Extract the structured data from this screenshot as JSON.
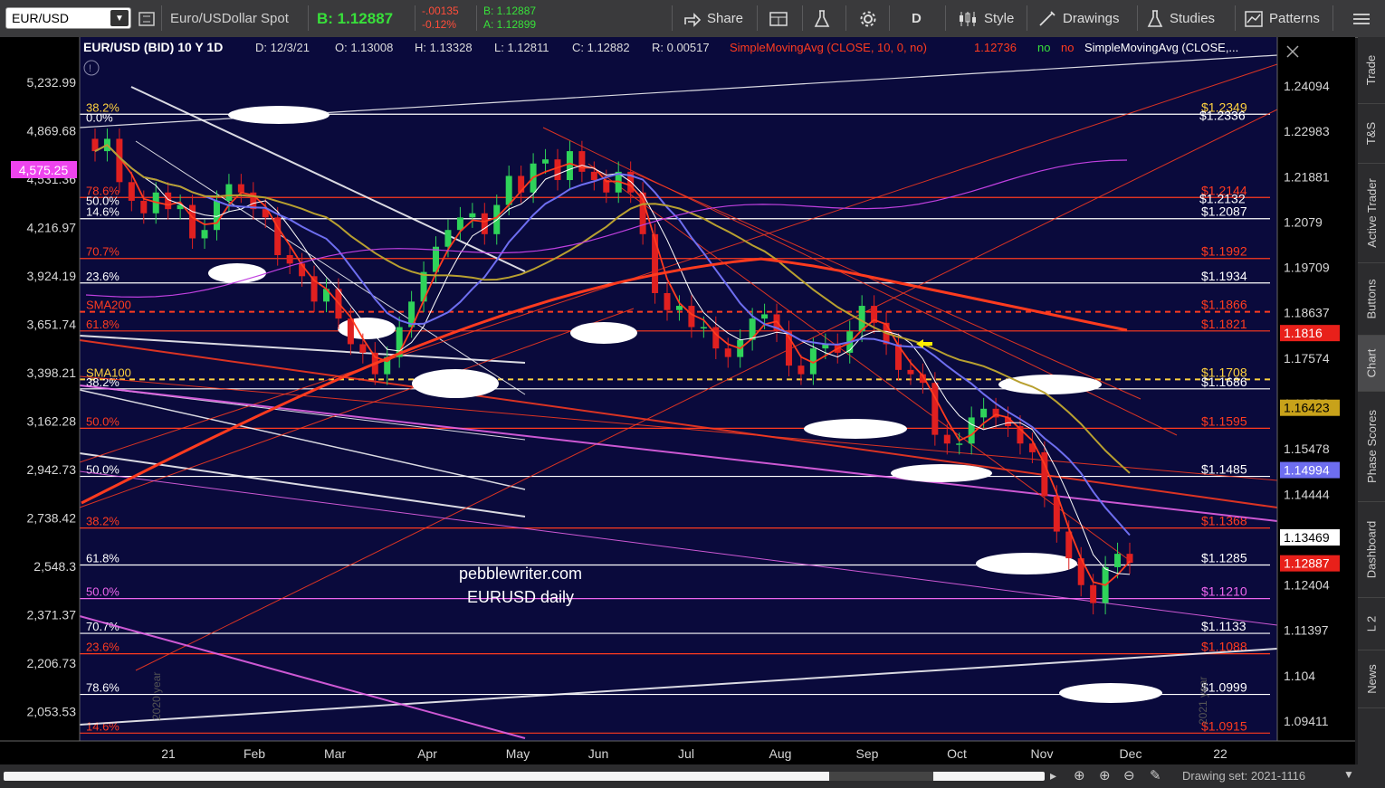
{
  "toolbar": {
    "symbol": "EUR/USD",
    "description": "Euro/USDollar Spot",
    "bid_label": "B: 1.12887",
    "change_abs": "-.00135",
    "change_pct": "-0.12%",
    "bid_small": "B: 1.12887",
    "ask_small": "A: 1.12899",
    "share": "Share",
    "period": "D",
    "style": "Style",
    "drawings": "Drawings",
    "studies": "Studies",
    "patterns": "Patterns"
  },
  "header": {
    "title": "EUR/USD (BID) 10 Y 1D",
    "date": "D: 12/3/21",
    "open": "O: 1.13008",
    "high": "H: 1.13328",
    "low": "L: 1.12811",
    "close": "C: 1.12882",
    "range": "R: 0.00517",
    "sma1": "SimpleMovingAvg (CLOSE, 10, 0, no)",
    "sma1_val": "1.12736",
    "no1": "no",
    "no2": "no",
    "sma2": "SimpleMovingAvg (CLOSE,..."
  },
  "watermark": {
    "line1": "pebblewriter.com",
    "line2": "EURUSD daily"
  },
  "year_labels": {
    "y2020": "2020 year",
    "y2021": "2021 year"
  },
  "right_tabs": [
    "Trade",
    "T&S",
    "Active Trader",
    "Buttons",
    "Chart",
    "Phase Scores",
    "Dashboard",
    "L 2",
    "News"
  ],
  "bottom": {
    "drawing_set": "Drawing set: 2021-1116"
  },
  "colors": {
    "background": "#000000",
    "plot": "#0a0a3c",
    "up": "#2fd35a",
    "down": "#e02020",
    "accent": "#ff3b1f"
  },
  "chart_data": {
    "type": "candlestick",
    "x_ticks": [
      "21",
      "Feb",
      "Mar",
      "Apr",
      "May",
      "Jun",
      "Jul",
      "Aug",
      "Sep",
      "Oct",
      "Nov",
      "Dec",
      "22"
    ],
    "right_axis_ticks": [
      "1.24094",
      "1.22983",
      "1.21881",
      "1.2079",
      "1.19709",
      "1.18637",
      "1.17574",
      "1.16523",
      "1.15478",
      "1.14444",
      "1.13421",
      "1.12404",
      "1.11397",
      "1.104",
      "1.09411"
    ],
    "left_axis_ticks": [
      "5,232.99",
      "4,869.68",
      "4,531.36",
      "4,216.97",
      "3,924.19",
      "3,651.74",
      "3,398.21",
      "3,162.28",
      "2,942.73",
      "2,738.42",
      "2,548.3",
      "2,371.37",
      "2,206.73",
      "2,053.53"
    ],
    "left_marker": "4,575.25",
    "price_tags": [
      {
        "label": "1.1816",
        "price": 1.1816,
        "bg": "#e8201a",
        "fg": "#ffffff"
      },
      {
        "label": "1.16423",
        "price": 1.16423,
        "bg": "#c8a21a",
        "fg": "#000000"
      },
      {
        "label": "1.14994",
        "price": 1.14994,
        "bg": "#6e6ef0",
        "fg": "#ffffff"
      },
      {
        "label": "1.13469",
        "price": 1.13469,
        "bg": "#ffffff",
        "fg": "#000000"
      },
      {
        "label": "1.12887",
        "price": 1.12887,
        "bg": "#e8201a",
        "fg": "#ffffff"
      }
    ],
    "levels": [
      {
        "left": "38.2%",
        "left2": "0.0%",
        "right": "$1.2349",
        "right2": "$1.2336",
        "price": 1.234,
        "color": "#ffffff",
        "lc": "#ffd23f",
        "rc": "#ffd23f"
      },
      {
        "left": "78.6%",
        "left2": "50.0%",
        "right": "$1.2144",
        "right2": "$1.2132",
        "price": 1.2138,
        "color": "#ff3b1f",
        "lc": "#ff3b1f",
        "rc": "#ff3b1f"
      },
      {
        "left": "14.6%",
        "right": "$1.2087",
        "price": 1.2087,
        "color": "#ffffff",
        "lc": "#ffffff",
        "rc": "#ffffff"
      },
      {
        "left": "70.7%",
        "right": "$1.1992",
        "price": 1.1992,
        "color": "#ff3b1f",
        "lc": "#ff3b1f",
        "rc": "#ff3b1f"
      },
      {
        "left": "23.6%",
        "right": "$1.1934",
        "price": 1.1934,
        "color": "#ffffff",
        "lc": "#ffffff",
        "rc": "#ffffff"
      },
      {
        "left": "SMA200",
        "right": "$1.1866",
        "price": 1.1866,
        "color": "#ff3b1f",
        "lc": "#ff3b1f",
        "rc": "#ff3b1f",
        "dash": true
      },
      {
        "left": "61.8%",
        "right": "$1.1821",
        "price": 1.1821,
        "color": "#ff3b1f",
        "lc": "#ff3b1f",
        "rc": "#ff3b1f"
      },
      {
        "left": "SMA100",
        "right": "$1.1708",
        "price": 1.1708,
        "color": "#ffd23f",
        "lc": "#ffd23f",
        "rc": "#ffd23f",
        "dash": true
      },
      {
        "left": "38.2%",
        "right": "$1.1686",
        "price": 1.1686,
        "color": "#ffffff",
        "lc": "#ffffff",
        "rc": "#ffffff"
      },
      {
        "left": "50.0%",
        "right": "$1.1595",
        "price": 1.1595,
        "color": "#ff3b1f",
        "lc": "#ff3b1f",
        "rc": "#ff3b1f"
      },
      {
        "left": "50.0%",
        "right": "$1.1485",
        "price": 1.1485,
        "color": "#ffffff",
        "lc": "#ffffff",
        "rc": "#ffffff"
      },
      {
        "left": "38.2%",
        "right": "$1.1368",
        "price": 1.1368,
        "color": "#ff3b1f",
        "lc": "#ff3b1f",
        "rc": "#ff3b1f"
      },
      {
        "left": "61.8%",
        "right": "$1.1285",
        "price": 1.1285,
        "color": "#ffffff",
        "lc": "#ffffff",
        "rc": "#ffffff"
      },
      {
        "left": "50.0%",
        "right": "$1.1210",
        "price": 1.121,
        "color": "#ee66ee",
        "lc": "#ee66ee",
        "rc": "#ee66ee"
      },
      {
        "left": "70.7%",
        "right": "$1.1133",
        "price": 1.1133,
        "color": "#ffffff",
        "lc": "#ffffff",
        "rc": "#ffffff"
      },
      {
        "left": "23.6%",
        "right": "$1.1088",
        "price": 1.1088,
        "color": "#ff3b1f",
        "lc": "#ff3b1f",
        "rc": "#ff3b1f"
      },
      {
        "left": "78.6%",
        "right": "$1.0999",
        "price": 1.0999,
        "color": "#ffffff",
        "lc": "#ffffff",
        "rc": "#ffffff"
      },
      {
        "left": "14.6%",
        "right": "$1.0915",
        "price": 1.0915,
        "color": "#ff3b1f",
        "lc": "#ff3b1f",
        "rc": "#ff3b1f"
      }
    ],
    "closes": [
      1.225,
      1.228,
      1.2175,
      1.213,
      1.21,
      1.215,
      1.211,
      1.212,
      1.204,
      1.206,
      1.213,
      1.217,
      1.215,
      1.211,
      1.209,
      1.2,
      1.198,
      1.195,
      1.189,
      1.192,
      1.185,
      1.179,
      1.177,
      1.172,
      1.176,
      1.183,
      1.189,
      1.196,
      1.202,
      1.206,
      1.209,
      1.21,
      1.205,
      1.212,
      1.219,
      1.215,
      1.222,
      1.223,
      1.218,
      1.225,
      1.22,
      1.218,
      1.215,
      1.22,
      1.215,
      1.205,
      1.191,
      1.187,
      1.188,
      1.183,
      1.183,
      1.178,
      1.176,
      1.18,
      1.185,
      1.186,
      1.182,
      1.174,
      1.172,
      1.178,
      1.179,
      1.177,
      1.182,
      1.188,
      1.184,
      1.179,
      1.173,
      1.172,
      1.17,
      1.158,
      1.156,
      1.156,
      1.162,
      1.164,
      1.162,
      1.16,
      1.156,
      1.154,
      1.144,
      1.136,
      1.13,
      1.124,
      1.12,
      1.128,
      1.131,
      1.129
    ]
  }
}
